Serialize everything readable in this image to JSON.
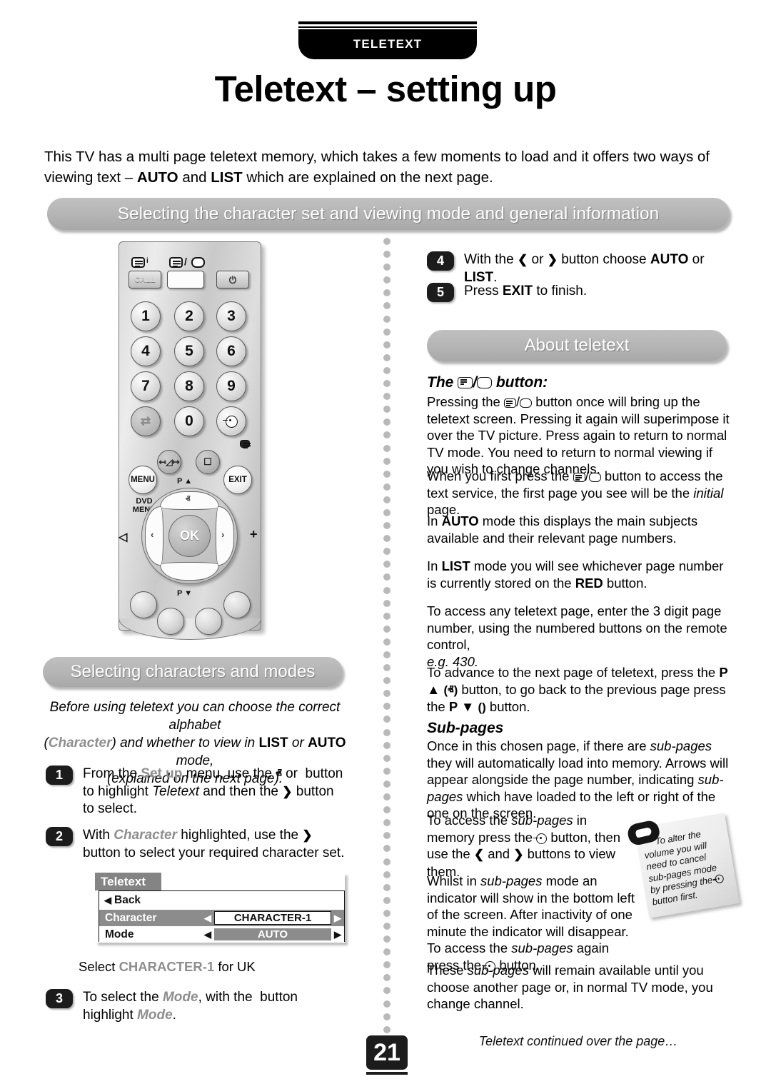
{
  "header": {
    "tab_label": "TELETEXT",
    "title": "Teletext – setting up"
  },
  "intro": {
    "line1_a": "This TV has a multi page teletext memory, which takes a few moments to load and it offers two ways of viewing text – ",
    "auto": "AUTO",
    "and": " and ",
    "list": "LIST",
    "line1_b": " which are explained on the next page."
  },
  "banners": {
    "main": "Selecting the character set and viewing mode and general information",
    "characters": "Selecting characters and modes",
    "about": "About teletext"
  },
  "remote": {
    "top_buttons": [
      {
        "name": "call-button",
        "label": "CALL",
        "icon": "teletext-index-icon"
      },
      {
        "name": "teletext-mix-button",
        "label": "",
        "icon": "teletext-mix-icon"
      },
      {
        "name": "power-button",
        "label": "⏻",
        "icon": "power-icon"
      }
    ],
    "keys": [
      "1",
      "2",
      "3",
      "4",
      "5",
      "6",
      "7",
      "8",
      "9"
    ],
    "key_zero": "0",
    "key_swap": "⇄",
    "key_source": "source-icon",
    "corner_icon": "picture-icon",
    "mute_icon": "mute-icon",
    "format_icon": "widescreen-icon",
    "menu_label": "MENU",
    "dvd_menu_label": "DVD\nMENU",
    "exit_label": "EXIT",
    "ok_label": "OK",
    "p_up_label": "P ▲",
    "p_down_label": "P ▼",
    "vol_down_label": "◁",
    "vol_up_label": "+",
    "chev_up": "ⱏ",
    "chev_down": "ⱟ",
    "chev_left": "‹",
    "chev_right": "›"
  },
  "left_column": {
    "note_line1": "Before using teletext you can choose the correct alphabet",
    "note_line2_pre": "(",
    "note_character": "Character",
    "note_line2_mid": ") and whether to view in ",
    "note_list": "LIST",
    "note_or": " or ",
    "note_auto": "AUTO",
    "note_line2_post": " mode,",
    "note_line3": "(explained on the next page).",
    "steps": [
      {
        "num": "1",
        "text_parts": [
          "From the ",
          "Set up",
          " menu, use the ",
          "ⱏ",
          " or ",
          "ⱟ",
          " button to highlight ",
          "Teletext",
          " and then the ",
          "❯",
          " button to select."
        ]
      },
      {
        "num": "2",
        "text_parts": [
          "With ",
          "Character",
          " highlighted, use the ",
          "❯",
          " button to select your required character set."
        ]
      },
      {
        "num": "3",
        "text_parts": [
          "To select the ",
          "Mode",
          ", with the ",
          "ⱟ",
          " button highlight ",
          "Mode",
          "."
        ]
      }
    ],
    "uk_note_pre": "Select ",
    "uk_note_value": "CHARACTER-1",
    "uk_note_post": " for UK"
  },
  "osd_menu": {
    "title": "Teletext",
    "back_label": "Back",
    "back_arrow": "◀",
    "rows": [
      {
        "label": "Character",
        "value": "CHARACTER-1",
        "selected": true
      },
      {
        "label": "Mode",
        "value": "AUTO",
        "selected": false
      }
    ],
    "left_arrow": "◀",
    "right_arrow": "▶"
  },
  "right_column": {
    "steps": [
      {
        "num": "4",
        "parts": [
          "With the ",
          "❮",
          " or ",
          "❯",
          " button choose ",
          "AUTO",
          " or ",
          "LIST",
          "."
        ]
      },
      {
        "num": "5",
        "parts": [
          "Press ",
          "EXIT",
          " to finish."
        ]
      }
    ],
    "button_heading_pre": "The ",
    "button_heading_slash": "/",
    "button_heading_post": " button:",
    "p1": "Pressing the  button once will bring up the teletext screen. Pressing it again will superimpose it over the TV picture. Press again to return to normal TV mode. You need to return to normal viewing if you wish to change channels.",
    "p2": "When you first press the  button to access the text service, the first page you see will be the initial page.",
    "p3_pre": "In ",
    "p3_auto": "AUTO",
    "p3_post": " mode this displays the main subjects available and their relevant page numbers.",
    "p4_pre": "In ",
    "p4_list": "LIST",
    "p4_mid": " mode you will see whichever page number is currently stored on the ",
    "p4_red": "RED",
    "p4_post": " button.",
    "p5": "To access any teletext page, enter the 3 digit page number, using the numbered buttons on the remote control, e.g. 430.",
    "p5_eg": "e.g. 430.",
    "p6_pre": "To advance to the next page of teletext, press the ",
    "p6_pup": "P ▲",
    "p6_pup_chev": "(ⱏ)",
    "p6_mid": " button, to go back to the previous page press the ",
    "p6_pdn": "P ▼",
    "p6_pdn_chev": "(ⱟ)",
    "p6_post": " button.",
    "subpages_heading": "Sub-pages",
    "p7": "Once in this chosen page, if there are sub-pages they will automatically load into memory. Arrows will appear alongside the page number, indicating sub-pages which have loaded to the left or right of the one on the screen.",
    "p8": "To access the sub-pages in memory press the  button, then use the ❮ and ❯ buttons to view them.",
    "p9": "Whilst in sub-pages mode an indicator will show in the bottom left of the screen. After inactivity of one minute the indicator will disappear. To access the sub-pages again press the  button.",
    "p10": "These sub-pages will remain available until you choose another page or, in normal TV mode, you change channel."
  },
  "callout": {
    "text": "To alter the volume you will need to cancel sub-pages mode by pressing the  button first."
  },
  "footer": {
    "page_number": "21",
    "continued": "Teletext continued over the page…"
  },
  "colors": {
    "banner_grey": "#b4b4b4",
    "osd_selected": "#8c8c8c",
    "grey_text": "#8e8e8e",
    "black": "#000000"
  }
}
